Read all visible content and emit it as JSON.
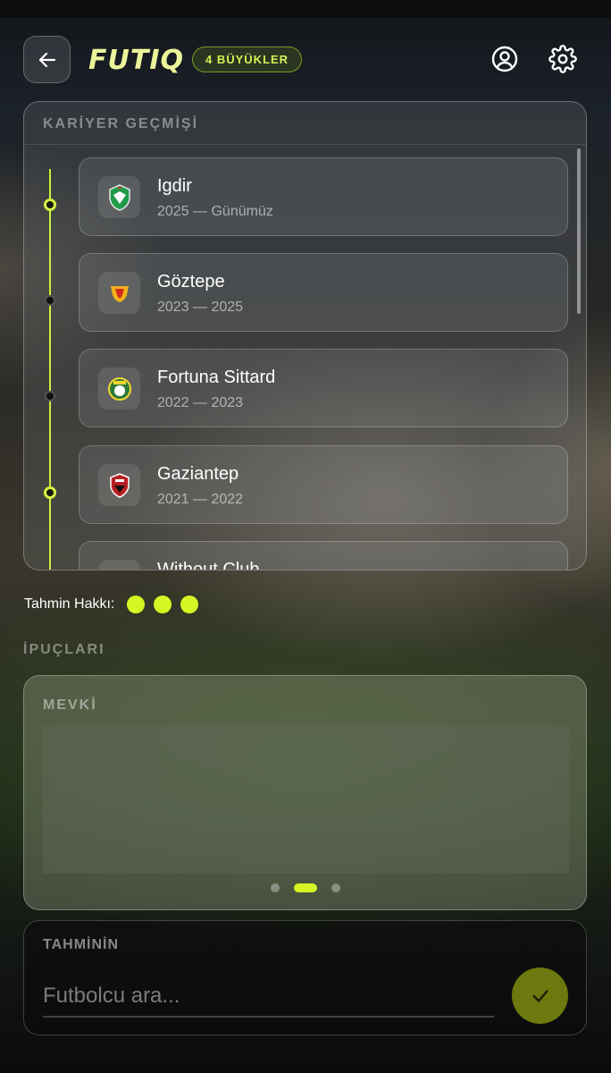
{
  "header": {
    "logo": "FUTIQ",
    "mode_badge": "4 BÜYÜKLER",
    "back_icon": "arrow-left-icon",
    "profile_icon": "user-circle-icon",
    "settings_icon": "gear-icon"
  },
  "career": {
    "title": "KARİYER GEÇMİŞİ",
    "clubs": [
      {
        "name": "Igdir",
        "years": "2025 — Günümüz",
        "active": true
      },
      {
        "name": "Göztepe",
        "years": "2023 — 2025",
        "active": false
      },
      {
        "name": "Fortuna Sittard",
        "years": "2022 — 2023",
        "active": false
      },
      {
        "name": "Gaziantep",
        "years": "2021 — 2022",
        "active": true
      },
      {
        "name": "Without Club",
        "years": "",
        "active": false
      }
    ]
  },
  "guesses": {
    "label": "Tahmin Hakkı:",
    "remaining": 3
  },
  "hints": {
    "title": "İPUÇLARI",
    "current_label": "MEVKİ",
    "page": 2,
    "pages": 3
  },
  "guess_input": {
    "title": "TAHMİNİN",
    "placeholder": "Futbolcu ara..."
  },
  "colors": {
    "accent": "#d6f524",
    "logo": "#ecf59a",
    "submit": "#6d780e"
  }
}
